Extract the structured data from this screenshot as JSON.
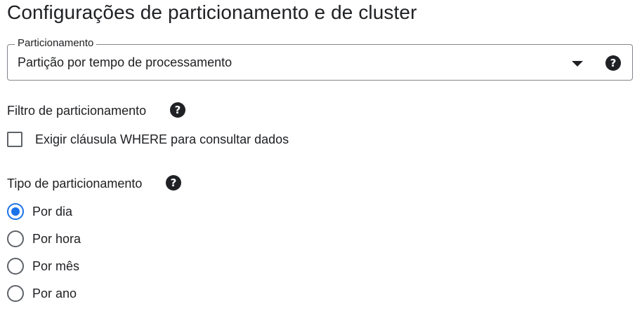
{
  "page": {
    "title": "Configurações de particionamento e de cluster"
  },
  "partitioning": {
    "label": "Particionamento",
    "value": "Partição por tempo de processamento",
    "dropdown_icon": "arrow-drop-down-icon",
    "help_icon": "help-icon"
  },
  "partition_filter": {
    "heading": "Filtro de particionamento",
    "checkbox_label": "Exigir cláusula WHERE para consultar dados",
    "checked": false
  },
  "partition_type": {
    "heading": "Tipo de particionamento",
    "selected": "Por dia",
    "options": [
      "Por dia",
      "Por hora",
      "Por mês",
      "Por ano"
    ]
  },
  "colors": {
    "accent": "#1a73e8",
    "text": "#202124",
    "border": "#80868b"
  }
}
